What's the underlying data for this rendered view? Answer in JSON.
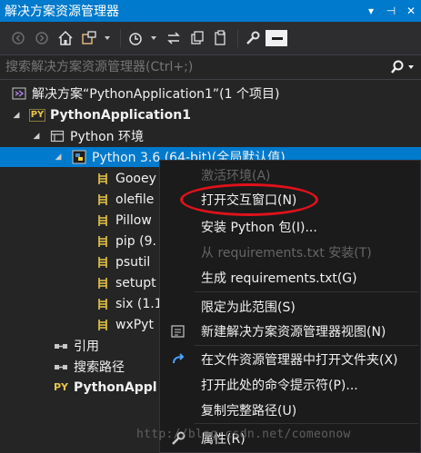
{
  "window": {
    "title": "解决方案资源管理器",
    "controls": [
      "▾",
      "⊣",
      "✕"
    ]
  },
  "toolbar": {
    "icons": [
      "back-icon",
      "forward-icon",
      "home-icon",
      "switch-views-icon",
      "history-icon",
      "sync-icon",
      "collapse-all-icon",
      "show-all-files-icon",
      "properties-icon",
      "preview-icon"
    ]
  },
  "search": {
    "placeholder": "搜索解决方案资源管理器(Ctrl+;)"
  },
  "tree": {
    "solution": "解决方案“PythonApplication1”(1 个项目)",
    "project": "PythonApplication1",
    "env_folder": "Python 环境",
    "env_selected": "Python 3.6 (64-bit)(全局默认值)",
    "packages": [
      "Gooey",
      "olefile",
      "Pillow",
      "pip (9.",
      "psutil",
      "setupt",
      "six (1.1",
      "wxPyt"
    ],
    "references": "引用",
    "search_paths": "搜索路径",
    "project_file": "PythonAppl"
  },
  "menu": {
    "activate_env": "激活环境(A)",
    "open_interactive": "打开交互窗口(N)",
    "install_package": "安装 Python 包(I)...",
    "install_from_requirements": "从 requirements.txt 安装(T)",
    "generate_requirements": "生成 requirements.txt(G)",
    "scope_to_this": "限定为此范围(S)",
    "new_view": "新建解决方案资源管理器视图(N)",
    "open_in_explorer": "在文件资源管理器中打开文件夹(X)",
    "open_cmd": "打开此处的命令提示符(P)...",
    "copy_full_path": "复制完整路径(U)",
    "properties": "属性(R)"
  },
  "watermark": "http://blog.csdn.net/comeonow",
  "colors": {
    "titlebar": "#007acc",
    "background": "#252526",
    "selection": "#007acc",
    "highlight_oval": "#e0121a",
    "python_badge": "#e8c547"
  }
}
